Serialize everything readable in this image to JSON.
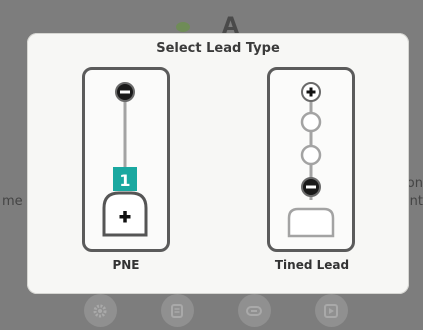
{
  "background": {
    "title": "A",
    "left_text": "me",
    "right_text_1": "on",
    "right_text_2": "nt",
    "nav": [
      {
        "icon": "gear-icon"
      },
      {
        "icon": "document-icon"
      },
      {
        "icon": "link-icon"
      },
      {
        "icon": "play-icon"
      }
    ]
  },
  "dialog": {
    "title": "Select Lead Type",
    "options": [
      {
        "label": "PNE",
        "badge": "1",
        "icon": "pne-lead-icon"
      },
      {
        "label": "Tined Lead",
        "icon": "tined-lead-icon"
      }
    ]
  },
  "colors": {
    "badge": "#1aa8a0",
    "overlay": "#7d7d7d",
    "dialog": "#f7f7f5"
  }
}
